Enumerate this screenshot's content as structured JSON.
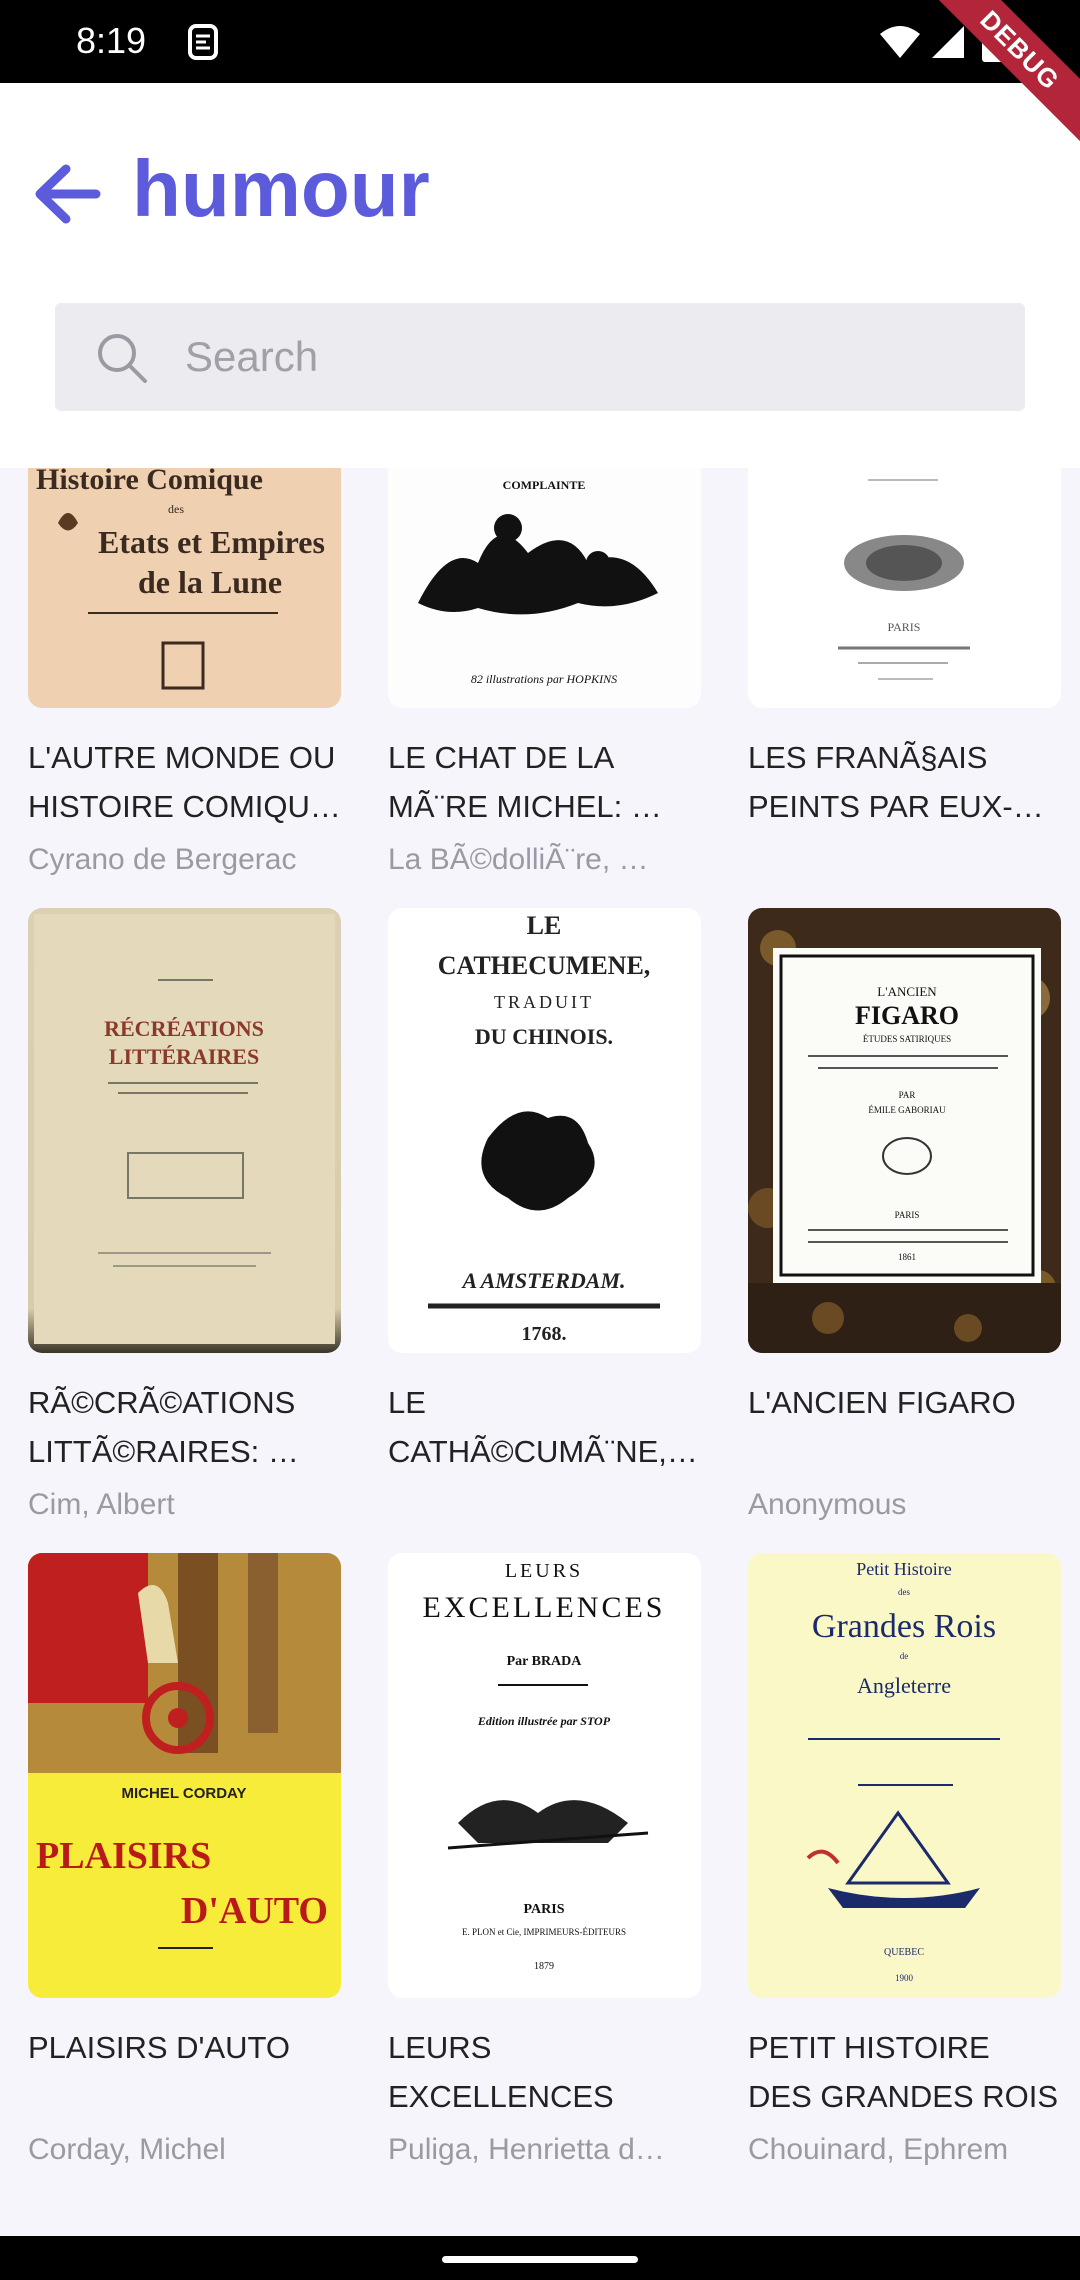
{
  "status_bar": {
    "time": "8:19",
    "debug_label": "DEBUG"
  },
  "app_bar": {
    "title": "humour"
  },
  "search": {
    "placeholder": "Search",
    "value": ""
  },
  "books": [
    {
      "title": "L'AUTRE MONDE OU HISTOIRE COMIQU…",
      "author": "Cyrano de Bergerac",
      "cover_lines": [
        "Histoire Comique",
        "des",
        "Etats et Empires",
        "de la Lune"
      ]
    },
    {
      "title": "LE CHAT DE LA MÃ¨RE MICHEL: …",
      "author": "La BÃ©dolliÃ¨re, …",
      "cover_lines": [
        "COMPLAINTE",
        "82 illustrations par HOPKINS"
      ]
    },
    {
      "title": "LES FRANÃ§AIS PEINTS PAR EUX-…",
      "author": "",
      "cover_lines": [
        "PARIS"
      ]
    },
    {
      "title": "RÃ©CRÃ©ATIONS LITTÃ©RAIRES: …",
      "author": "Cim, Albert",
      "cover_lines": [
        "RÉCRÉATIONS",
        "LITTÉRAIRES"
      ]
    },
    {
      "title": "LE CATHÃ©CUMÃ¨NE,…",
      "author": "",
      "cover_lines": [
        "LE",
        "CATHECUMENE,",
        "TRADUIT",
        "DU CHINOIS.",
        "A AMSTERDAM.",
        "1768."
      ]
    },
    {
      "title": "L'ANCIEN FIGARO",
      "author": "Anonymous",
      "cover_lines": [
        "L'ANCIEN",
        "FIGARO",
        "ÉTUDES SATIRIQUES",
        "PAR",
        "ÉMILE GABORIAU",
        "PARIS",
        "1861"
      ]
    },
    {
      "title": "PLAISIRS D'AUTO",
      "author": "Corday, Michel",
      "cover_lines": [
        "MICHEL CORDAY",
        "PLAISIRS",
        "D'AUTO"
      ]
    },
    {
      "title": "LEURS EXCELLENCES",
      "author": "Puliga, Henrietta d…",
      "cover_lines": [
        "LEURS",
        "EXCELLENCES",
        "Par BRADA",
        "Edition illustrée par STOP",
        "PARIS",
        "E. PLON et Cie, IMPRIMEURS-ÉDITEURS",
        "1879"
      ]
    },
    {
      "title": "PETIT HISTOIRE DES GRANDES ROIS DE …",
      "author": "Chouinard, Ephrem",
      "cover_lines": [
        "Petit Histoire",
        "des",
        "Grandes Rois",
        "de",
        "Angleterre",
        "QUEBEC",
        "1900"
      ]
    }
  ],
  "colors": {
    "accent": "#5b5bdc",
    "content_bg": "#f5f5fb",
    "search_bg": "#ebebf0"
  }
}
